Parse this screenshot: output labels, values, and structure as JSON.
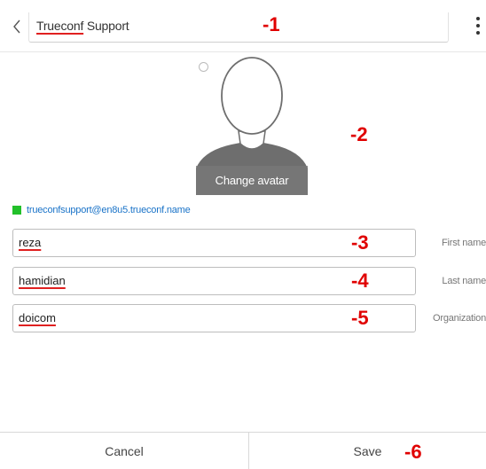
{
  "header": {
    "title_first": "Trueconf",
    "title_rest": " Support",
    "back_icon": "chevron-left-icon",
    "menu_icon": "more-vertical-icon"
  },
  "annotations": [
    "-1",
    "-2",
    "-3",
    "-4",
    "-5",
    "-6"
  ],
  "avatar": {
    "change_label": "Change avatar"
  },
  "status": {
    "color": "#22c02a",
    "email": "trueconfsupport@en8u5.trueconf.name"
  },
  "fields": [
    {
      "value": "reza",
      "label": "First name"
    },
    {
      "value": "hamidian",
      "label": "Last name"
    },
    {
      "value": "doicom",
      "label": "Organization"
    }
  ],
  "footer": {
    "cancel_label": "Cancel",
    "save_label": "Save"
  }
}
